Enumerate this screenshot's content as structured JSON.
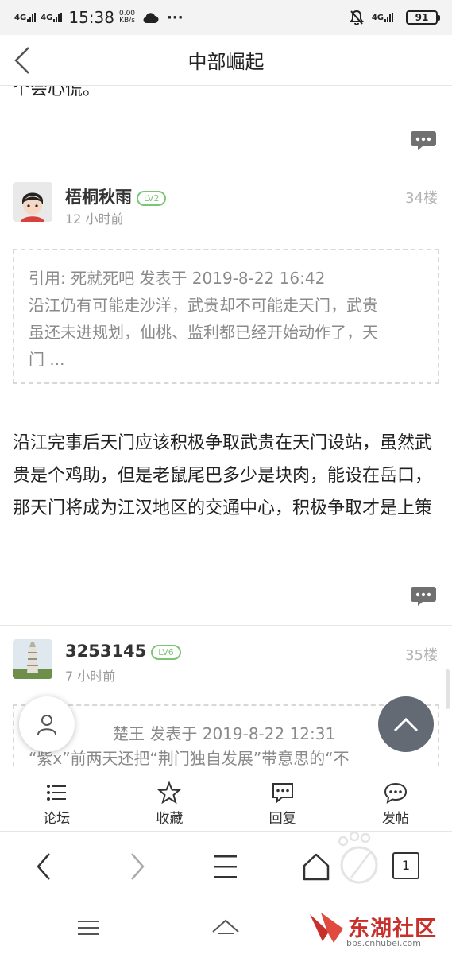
{
  "status_bar": {
    "signal1": "4G",
    "signal2": "4G",
    "time": "15:38",
    "speed_value": "0.00",
    "speed_unit": "KB/s",
    "more": "···",
    "network_right": "4G",
    "battery": "91"
  },
  "header": {
    "title": "中部崛起"
  },
  "posts": [
    {
      "clipped_text": "个会心慌。"
    },
    {
      "username": "梧桐秋雨",
      "level": "LV2",
      "time": "12 小时前",
      "floor": "34楼",
      "quote_header": "引用: 死就死吧 发表于 2019-8-22 16:42",
      "quote_lines": [
        "沿江仍有可能走沙洋，武贵却不可能走天门，武贵",
        "虽还未进规划，仙桃、监利都已经开始动作了，天",
        "门 ..."
      ],
      "body": "沿江完事后天门应该积极争取武贵在天门设站，虽然武贵是个鸡助，但是老鼠尾巴多少是块肉，能设在岳口，那天门将成为江汉地区的交通中心，积极争取才是上策"
    },
    {
      "username": "3253145",
      "level": "LV6",
      "time": "7 小时前",
      "floor": "35楼",
      "quote_header": "楚王 发表于 2019-8-22 12:31",
      "quote_line": "“紫x”前两天还把“荆门独自发展”带意思的“不"
    }
  ],
  "forum_toolbar": [
    {
      "label": "论坛",
      "icon": "list-icon"
    },
    {
      "label": "收藏",
      "icon": "star-icon"
    },
    {
      "label": "回复",
      "icon": "reply-icon"
    },
    {
      "label": "发帖",
      "icon": "post-icon"
    }
  ],
  "browser": {
    "tab_count": "1"
  },
  "watermark": {
    "name": "东湖社区",
    "url": "bbs.cnhubei.com"
  },
  "colors": {
    "level_badge": "#7cc576",
    "fab_top": "#636a73",
    "watermark_red": "#c8312b"
  }
}
